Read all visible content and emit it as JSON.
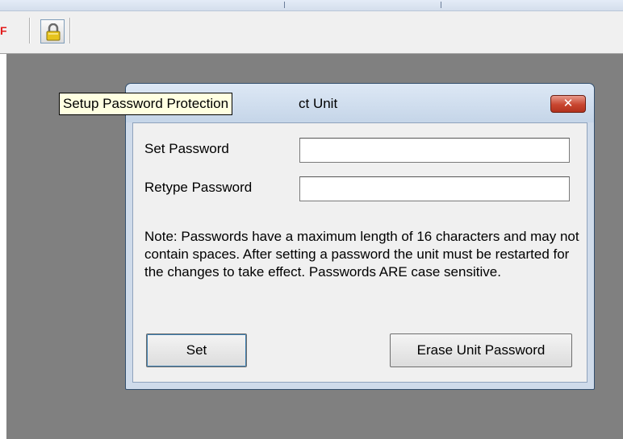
{
  "toolbar": {
    "fragment_glyph": "F",
    "lock_button_icon": "padlock-icon",
    "tooltip": "Setup Password Protection"
  },
  "dialog": {
    "title_visible": "ct Unit",
    "close_icon": "close-x-icon",
    "close_glyph": "✕",
    "set_password_label": "Set Password",
    "set_password_value": "",
    "retype_password_label": "Retype Password",
    "retype_password_value": "",
    "note": "Note: Passwords have a maximum length of 16 characters and may not contain spaces. After setting a password the unit must be restarted for the changes to take effect. Passwords ARE case sensitive.",
    "set_button": "Set",
    "erase_button": "Erase Unit Password"
  },
  "colors": {
    "workspace": "#808080",
    "dialog_frame": "#cfdbea",
    "close_button": "#c8452f",
    "tooltip_bg": "#ffffe1",
    "lock_icon": "#e6c31c"
  }
}
